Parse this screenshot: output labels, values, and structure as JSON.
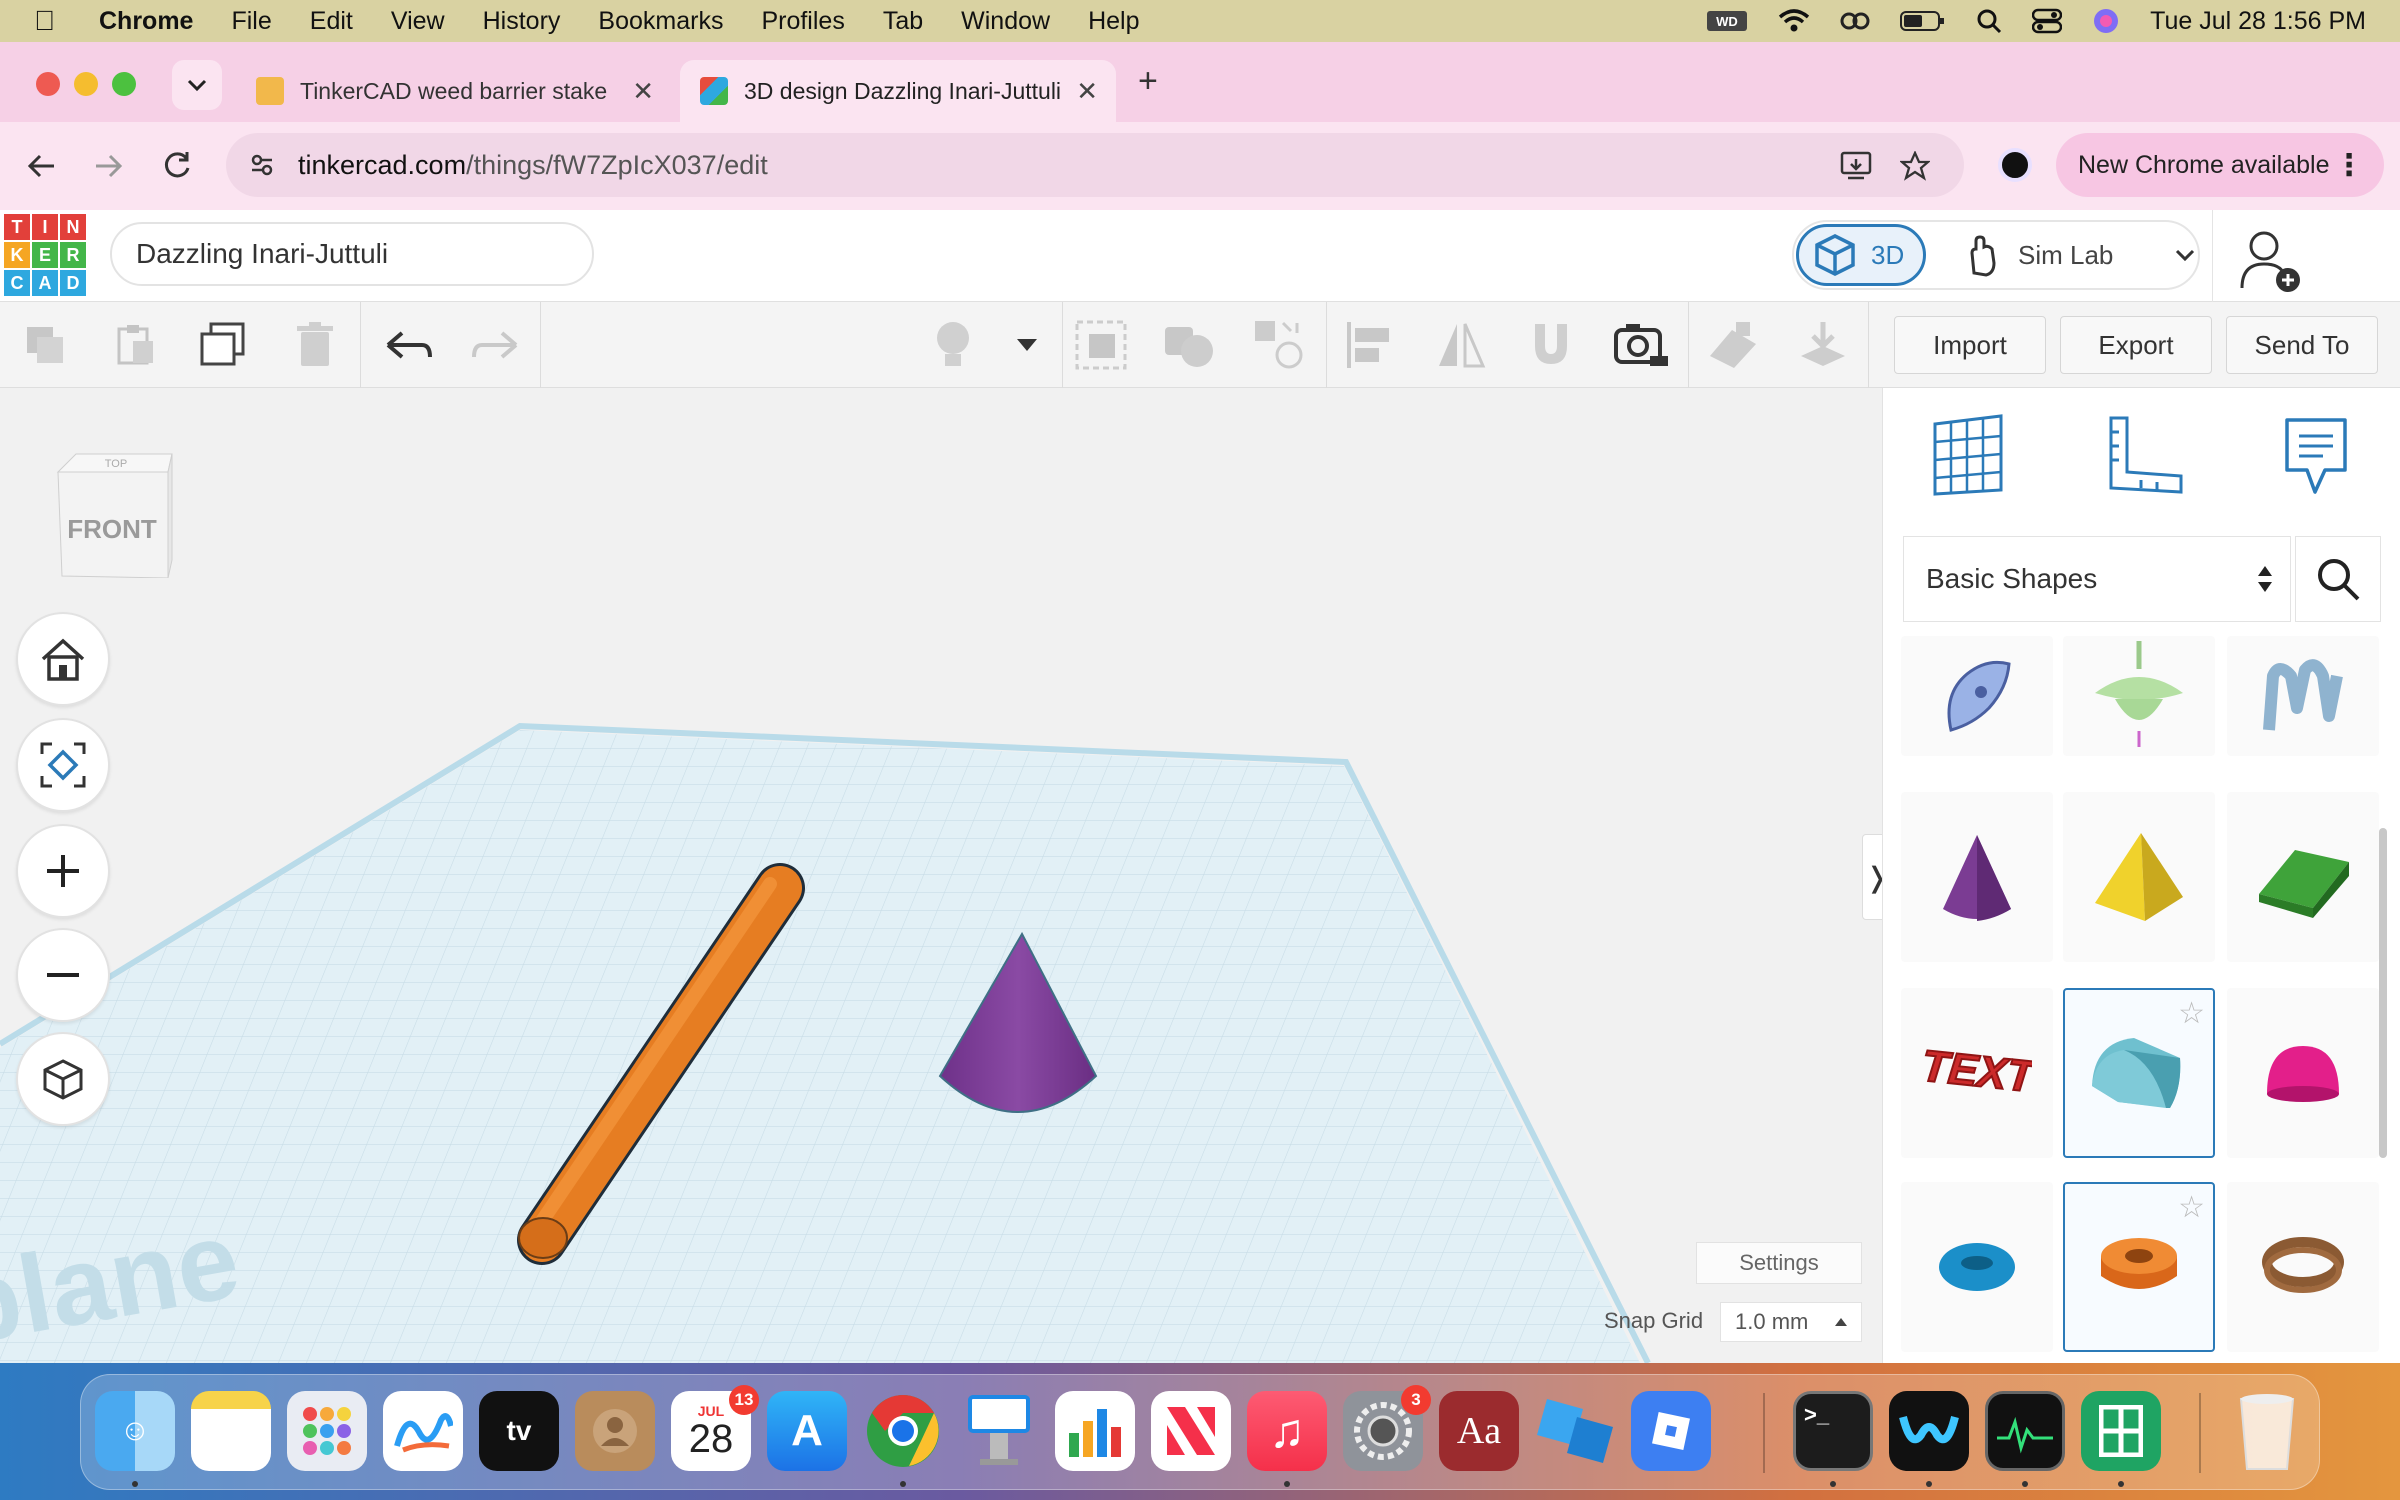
{
  "menubar": {
    "app": "Chrome",
    "items": [
      "File",
      "Edit",
      "View",
      "History",
      "Bookmarks",
      "Profiles",
      "Tab",
      "Window",
      "Help"
    ],
    "datetime": "Tue Jul 28  1:56 PM"
  },
  "tabs": [
    {
      "title": "TinkerCAD weed barrier stake",
      "active": false
    },
    {
      "title": "3D design Dazzling Inari-Juttuli",
      "active": true
    }
  ],
  "address": {
    "domain": "tinkercad.com",
    "path": "/things/fW7ZpIcX037/edit"
  },
  "new_chrome": "New Chrome available",
  "tinkercad": {
    "logo_letters": [
      "T",
      "I",
      "N",
      "K",
      "E",
      "R",
      "C",
      "A",
      "D"
    ],
    "design_title": "Dazzling Inari-Juttuli",
    "mode_3d": "3D",
    "sim_lab": "Sim Lab"
  },
  "toolbar": {
    "import": "Import",
    "export": "Export",
    "send_to": "Send To"
  },
  "viewcube": {
    "front": "FRONT",
    "top": "TOP"
  },
  "workplane": {
    "watermark": "plane",
    "settings": "Settings",
    "snap_label": "Snap Grid",
    "snap_value": "1.0 mm"
  },
  "panel": {
    "shapes_category": "Basic Shapes"
  },
  "dock": {
    "calendar_month": "JUL",
    "calendar_day": "28",
    "calendar_badge": "13",
    "settings_badge": "3"
  },
  "colors": {
    "accent": "#2b7ab8",
    "cylinder": "#e67d22",
    "cone": "#7b3c93",
    "grid": "#c9dfe9"
  }
}
